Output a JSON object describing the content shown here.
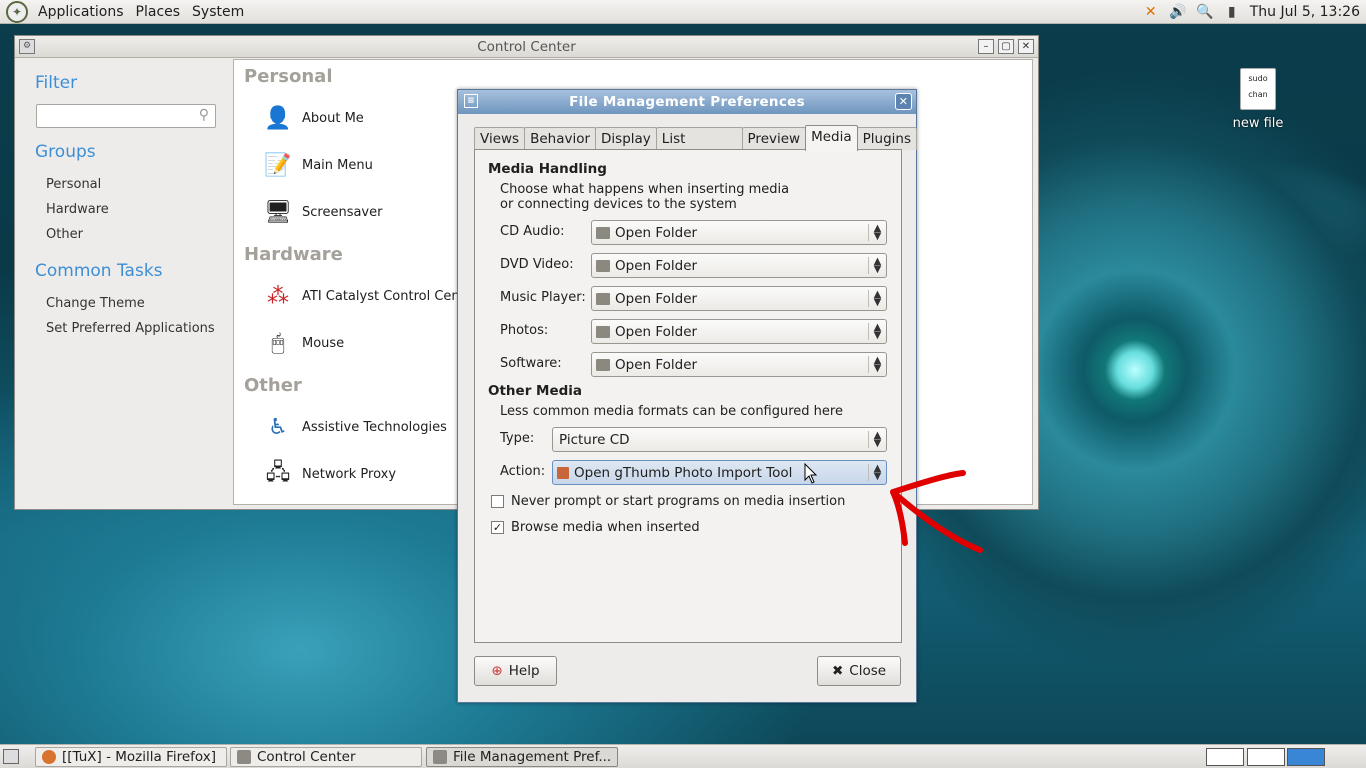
{
  "topbar": {
    "menus": [
      "Applications",
      "Places",
      "System"
    ],
    "clock": "Thu Jul  5, 13:26"
  },
  "desktop": {
    "file_icon_text": "sudo chan",
    "file_label": "new file"
  },
  "control_center": {
    "title": "Control Center",
    "sidebar": {
      "filter_heading": "Filter",
      "groups_heading": "Groups",
      "groups": [
        "Personal",
        "Hardware",
        "Other"
      ],
      "tasks_heading": "Common Tasks",
      "tasks": [
        "Change Theme",
        "Set Preferred Applications"
      ]
    },
    "sections": [
      {
        "heading": "Personal",
        "items": [
          "About Me",
          "Main Menu",
          "Screensaver"
        ]
      },
      {
        "heading": "Hardware",
        "items": [
          "ATI Catalyst Control Cent",
          "Mouse"
        ]
      },
      {
        "heading": "Other",
        "items": [
          "Assistive Technologies",
          "Network Proxy"
        ]
      }
    ]
  },
  "prefs": {
    "title": "File Management Preferences",
    "tabs": [
      "Views",
      "Behavior",
      "Display",
      "List Columns",
      "Preview",
      "Media",
      "Plugins"
    ],
    "active_tab": "Media",
    "media_handling": {
      "heading": "Media Handling",
      "description_line1": "Choose what happens when inserting media",
      "description_line2": "or connecting devices to the system",
      "rows": [
        {
          "label": "CD Audio:",
          "value": "Open Folder"
        },
        {
          "label": "DVD Video:",
          "value": "Open Folder"
        },
        {
          "label": "Music Player:",
          "value": "Open Folder"
        },
        {
          "label": "Photos:",
          "value": "Open Folder"
        },
        {
          "label": "Software:",
          "value": "Open Folder"
        }
      ]
    },
    "other_media": {
      "heading": "Other Media",
      "description": "Less common media formats can be configured here",
      "type_label": "Type:",
      "type_value": "Picture CD",
      "action_label": "Action:",
      "action_value": "Open gThumb Photo Import Tool"
    },
    "checkboxes": [
      {
        "label": "Never prompt or start programs on media insertion",
        "checked": false
      },
      {
        "label": "Browse media when inserted",
        "checked": true
      }
    ],
    "help_label": "Help",
    "close_label": "Close"
  },
  "taskbar": {
    "tasks": [
      "[[TuX] - Mozilla Firefox]",
      "Control Center",
      "File Management Pref..."
    ]
  },
  "colors": {
    "accent_blue": "#3d8ed6",
    "annotation_red": "#e00000",
    "title_bar": "#6f95bf"
  }
}
